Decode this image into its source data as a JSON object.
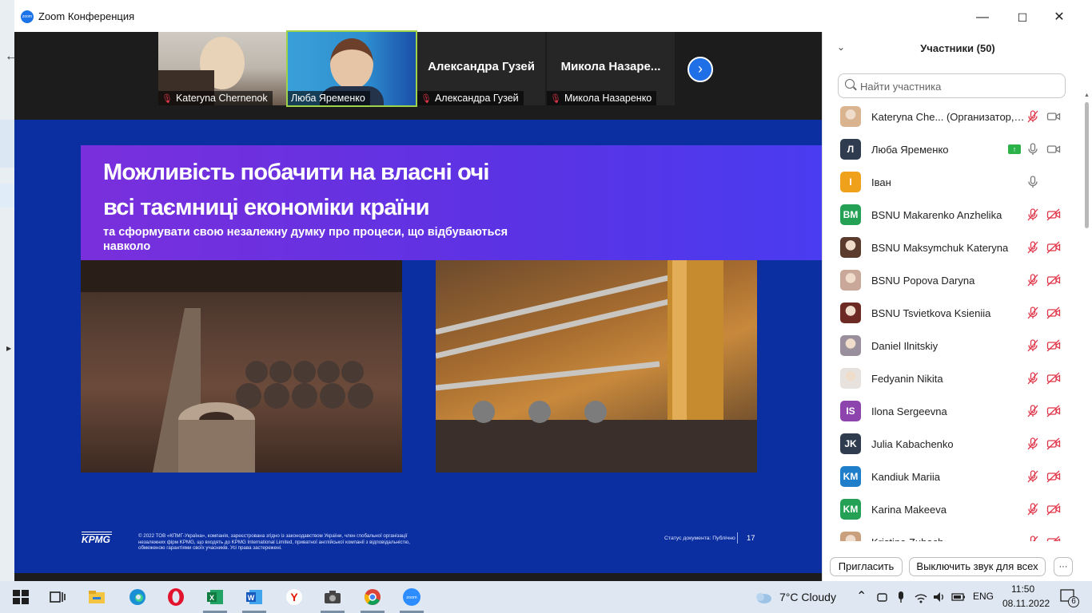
{
  "window": {
    "title": "Zoom Конференция",
    "minimize_label": "—",
    "maximize_label": "☐",
    "close_label": "✕"
  },
  "thumbnails": [
    {
      "name": "Kateryna Chernenok",
      "type": "video",
      "muted": true
    },
    {
      "name": "Люба Яременко",
      "type": "video",
      "muted": false,
      "active": true
    },
    {
      "name": "Александра Гузей",
      "display": "Александра  Гузей",
      "type": "name",
      "muted": true
    },
    {
      "name": "Микола Назаренко",
      "display": "Микола  Назаре...",
      "type": "name",
      "muted": true
    }
  ],
  "slide": {
    "title": "Можливість побачити на власні очі всі таємниці економіки країни",
    "subtitle": "та сформувати свою незалежну думку про процеси, що відбуваються навколо",
    "logo": "KPMG",
    "legal": "© 2022 ТОВ «КПМГ-Україна», компанія, зареєстрована згідно із законодавством України, член глобальної організації незалежних фірм KPMG, що входять до KPMG International Limited, приватної англійської компанії з відповідальністю, обмеженою гарантіями своїх учасників. Усі права застережені.",
    "doc_status": "Статус документа: Публічно",
    "page_number": "17"
  },
  "participants_panel": {
    "title": "Участники (50)",
    "search_placeholder": "Найти участника",
    "invite_label": "Пригласить",
    "mute_all_label": "Выключить звук для всех",
    "more_label": "···",
    "participants": [
      {
        "name": "Kateryna Che... (Организатор, я)",
        "avatar": "photo",
        "color": "#d9b48e",
        "mic": "off",
        "cam": "on"
      },
      {
        "name": "Люба Яременко",
        "avatar": "Л",
        "color": "#2f3b4f",
        "mic": "on",
        "cam": "on",
        "sharing": true
      },
      {
        "name": "Іван",
        "avatar": "I",
        "color": "#f0a11b",
        "mic": "on",
        "cam": "none"
      },
      {
        "name": "BSNU Makarenko Anzhelika",
        "avatar": "BM",
        "color": "#24a155",
        "mic": "off",
        "cam": "off"
      },
      {
        "name": "BSNU Maksymchuk Kateryna",
        "avatar": "photo",
        "color": "#5b3b2d",
        "mic": "off",
        "cam": "off"
      },
      {
        "name": "BSNU Popova Daryna",
        "avatar": "photo",
        "color": "#c9a89a",
        "mic": "off",
        "cam": "off"
      },
      {
        "name": "BSNU Tsvietkova Ksieniia",
        "avatar": "photo",
        "color": "#6d2a24",
        "mic": "off",
        "cam": "off"
      },
      {
        "name": "Daniel Ilnitskiy",
        "avatar": "photo",
        "color": "#9a8f9c",
        "mic": "off",
        "cam": "off"
      },
      {
        "name": "Fedyanin Nikita",
        "avatar": "photo",
        "color": "#e8e2de",
        "mic": "off",
        "cam": "off"
      },
      {
        "name": "Ilona Sergeevna",
        "avatar": "IS",
        "color": "#8e44ad",
        "mic": "off",
        "cam": "off"
      },
      {
        "name": "Julia Kabachenko",
        "avatar": "JK",
        "color": "#2f3b4f",
        "mic": "off",
        "cam": "off"
      },
      {
        "name": "Kandiuk Mariia",
        "avatar": "KM",
        "color": "#1f7ec9",
        "mic": "off",
        "cam": "off"
      },
      {
        "name": "Karina Makeeva",
        "avatar": "KM",
        "color": "#24a155",
        "mic": "off",
        "cam": "off"
      },
      {
        "name": "Kristina Zubach",
        "avatar": "photo",
        "color": "#caa07c",
        "mic": "off",
        "cam": "off"
      }
    ]
  },
  "taskbar": {
    "weather": "7°C  Cloudy",
    "language": "ENG",
    "time": "11:50",
    "date": "08.11.2022",
    "notifications": "6",
    "apps": [
      "start-icon",
      "task-view-icon",
      "file-explorer-icon",
      "edge-icon",
      "opera-icon",
      "excel-icon",
      "word-icon",
      "yandex-icon",
      "camera-app-icon",
      "chrome-icon",
      "zoom-icon"
    ]
  }
}
